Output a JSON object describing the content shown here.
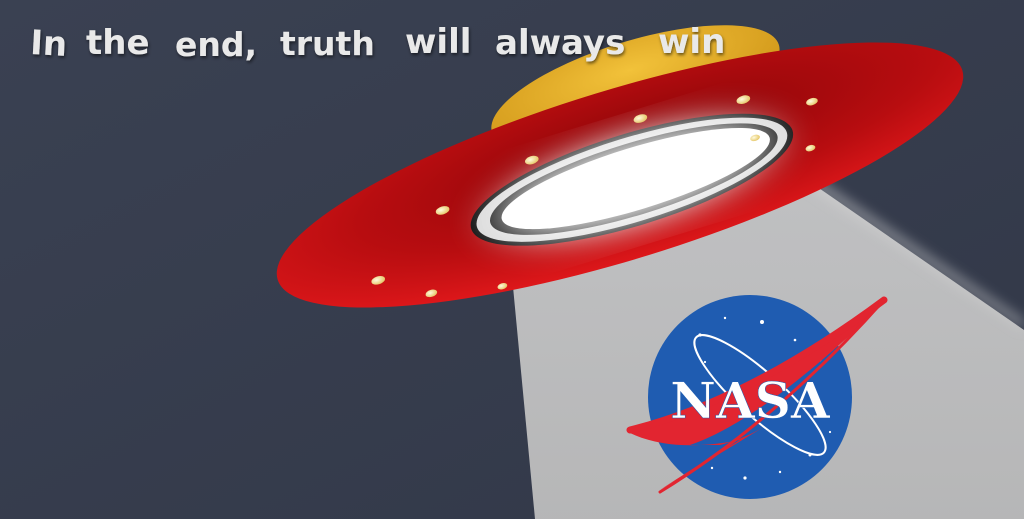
{
  "caption": {
    "words": [
      "In",
      "the",
      "end,",
      "truth",
      "will",
      "always",
      "win"
    ]
  },
  "logo": {
    "text": "NASA"
  },
  "colors": {
    "background": "#363d4e",
    "beam": "#c9c9c9",
    "saucer_rim": "#c40f12",
    "saucer_dome": "#e3a51a",
    "lights": "#f3e3a0",
    "logo_blue": "#1f5cb1",
    "logo_red": "#e22530",
    "caption": "#e9e9e9"
  }
}
